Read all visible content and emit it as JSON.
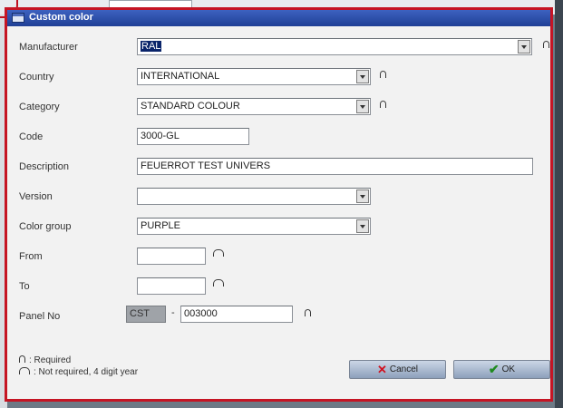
{
  "window": {
    "title": "Custom color"
  },
  "form": {
    "manufacturer": {
      "label": "Manufacturer",
      "value": "RAL"
    },
    "country": {
      "label": "Country",
      "value": "INTERNATIONAL"
    },
    "category": {
      "label": "Category",
      "value": "STANDARD COLOUR"
    },
    "code": {
      "label": "Code",
      "value": "3000-GL"
    },
    "description": {
      "label": "Description",
      "value": "FEUERROT TEST UNIVERS"
    },
    "version": {
      "label": "Version",
      "value": ""
    },
    "color_group": {
      "label": "Color group",
      "value": "PURPLE"
    },
    "from": {
      "label": "From",
      "value": ""
    },
    "to": {
      "label": "To",
      "value": ""
    },
    "panel_no": {
      "label": "Panel No",
      "prefix": "CST",
      "separator": "-",
      "value": "003000"
    }
  },
  "legend": {
    "required": ": Required",
    "year": ": Not required, 4 digit year"
  },
  "buttons": {
    "cancel": "Cancel",
    "ok": "OK"
  },
  "icons": {
    "window": "color-window-icon",
    "required": "required-marker-icon",
    "year": "year-marker-icon",
    "cancel": "red-x-icon",
    "ok": "green-check-icon"
  }
}
